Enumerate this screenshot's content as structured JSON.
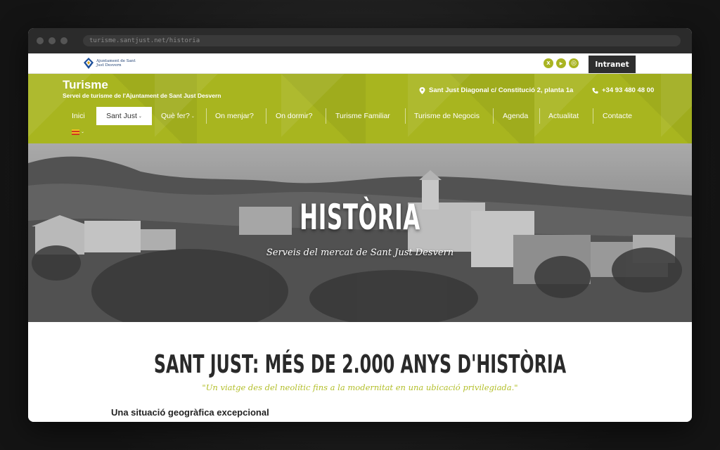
{
  "browser": {
    "url": "turisme.santjust.net/historia"
  },
  "topbar": {
    "logo_text": "Ajuntament de Sant Just Desvern",
    "social": [
      {
        "name": "x-icon",
        "glyph": "X"
      },
      {
        "name": "youtube-icon",
        "glyph": "▶"
      },
      {
        "name": "instagram-icon",
        "glyph": "◎"
      }
    ],
    "intranet_label": "Intranet"
  },
  "header": {
    "title": "Turisme",
    "subtitle": "Servei de turisme de l'Ajuntament de Sant Just Desvern",
    "address": "Sant Just Diagonal c/ Constitució 2, planta 1a",
    "phone": "+34 93 480 48 00"
  },
  "nav": {
    "items": [
      {
        "label": "Inici"
      },
      {
        "label": "Sant Just",
        "active": true,
        "dropdown": true
      },
      {
        "label": "Què fer?",
        "dropdown": true
      },
      {
        "label": "On menjar?"
      },
      {
        "label": "On dormir?"
      },
      {
        "label": "Turisme Familiar"
      },
      {
        "label": "Turisme de Negocis"
      },
      {
        "label": "Agenda"
      },
      {
        "label": "Actualitat"
      },
      {
        "label": "Contacte"
      }
    ],
    "language_flag": "catalan-flag"
  },
  "hero": {
    "title": "HISTÒRIA",
    "subtitle": "Serveis del mercat de Sant Just Desvern"
  },
  "content": {
    "title": "SANT JUST: MÉS DE 2.000 ANYS D'HISTÒRIA",
    "quote": "\"Un viatge des del neolític fins a la modernitat en una ubicació privilegiada.\"",
    "section_title": "Una situació geogràfica excepcional"
  },
  "colors": {
    "brand_green": "#a8b51f",
    "accent_green": "#b3bf2a",
    "dark_button": "#2e2e2e"
  }
}
